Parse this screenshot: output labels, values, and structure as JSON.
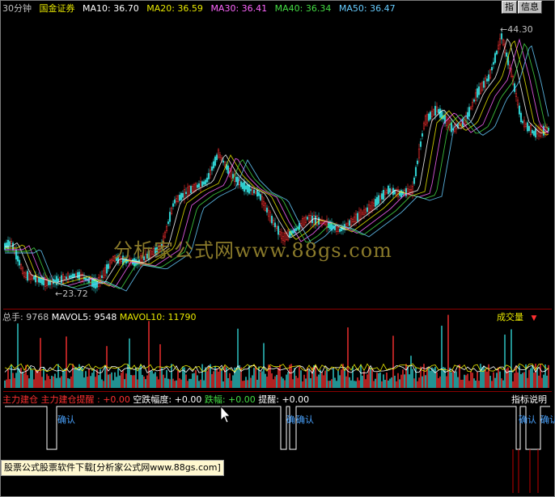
{
  "header": {
    "period": "30分钟",
    "stock": "国金证券",
    "ma": [
      {
        "label": "MA10: 36.70",
        "color": "#ffffff"
      },
      {
        "label": "MA20: 36.59",
        "color": "#e8e800"
      },
      {
        "label": "MA30: 36.41",
        "color": "#ff66ff"
      },
      {
        "label": "MA40: 36.34",
        "color": "#44dd44"
      },
      {
        "label": "MA50: 36.47",
        "color": "#66ccff"
      }
    ],
    "btn_index": "指",
    "btn_info": "信息"
  },
  "price": {
    "high_label": "←44.30",
    "low_label": "←23.72",
    "watermark": "分析家公式网www.88gs.com"
  },
  "volume": {
    "total": "总手: 9768",
    "mavol5": "MAVOL5: 9548",
    "mavol10": "MAVOL10: 11790",
    "selector": "成交量",
    "selector_arrow": "▼"
  },
  "indicator": {
    "label1": "主力建仓",
    "label2": "主力建仓提醒",
    "val1": ": +0.00",
    "label3": "空跌幅度",
    "val3": ": +0.00",
    "label4": "跌幅",
    "val4": ": +0.00",
    "label5": "提醒",
    "val5": ": +0.00",
    "help": "指标说明",
    "confirm": "确认",
    "confirm_cut": "确",
    "confirm_tail": "确认"
  },
  "status": {
    "text": "股票公式股票软件下载[分析家公式网www.88gs.com]"
  },
  "colors": {
    "up": "#ff3030",
    "down": "#30d0d0",
    "grid_sep": "#8b0000",
    "accent": "#c0c0c0"
  }
}
